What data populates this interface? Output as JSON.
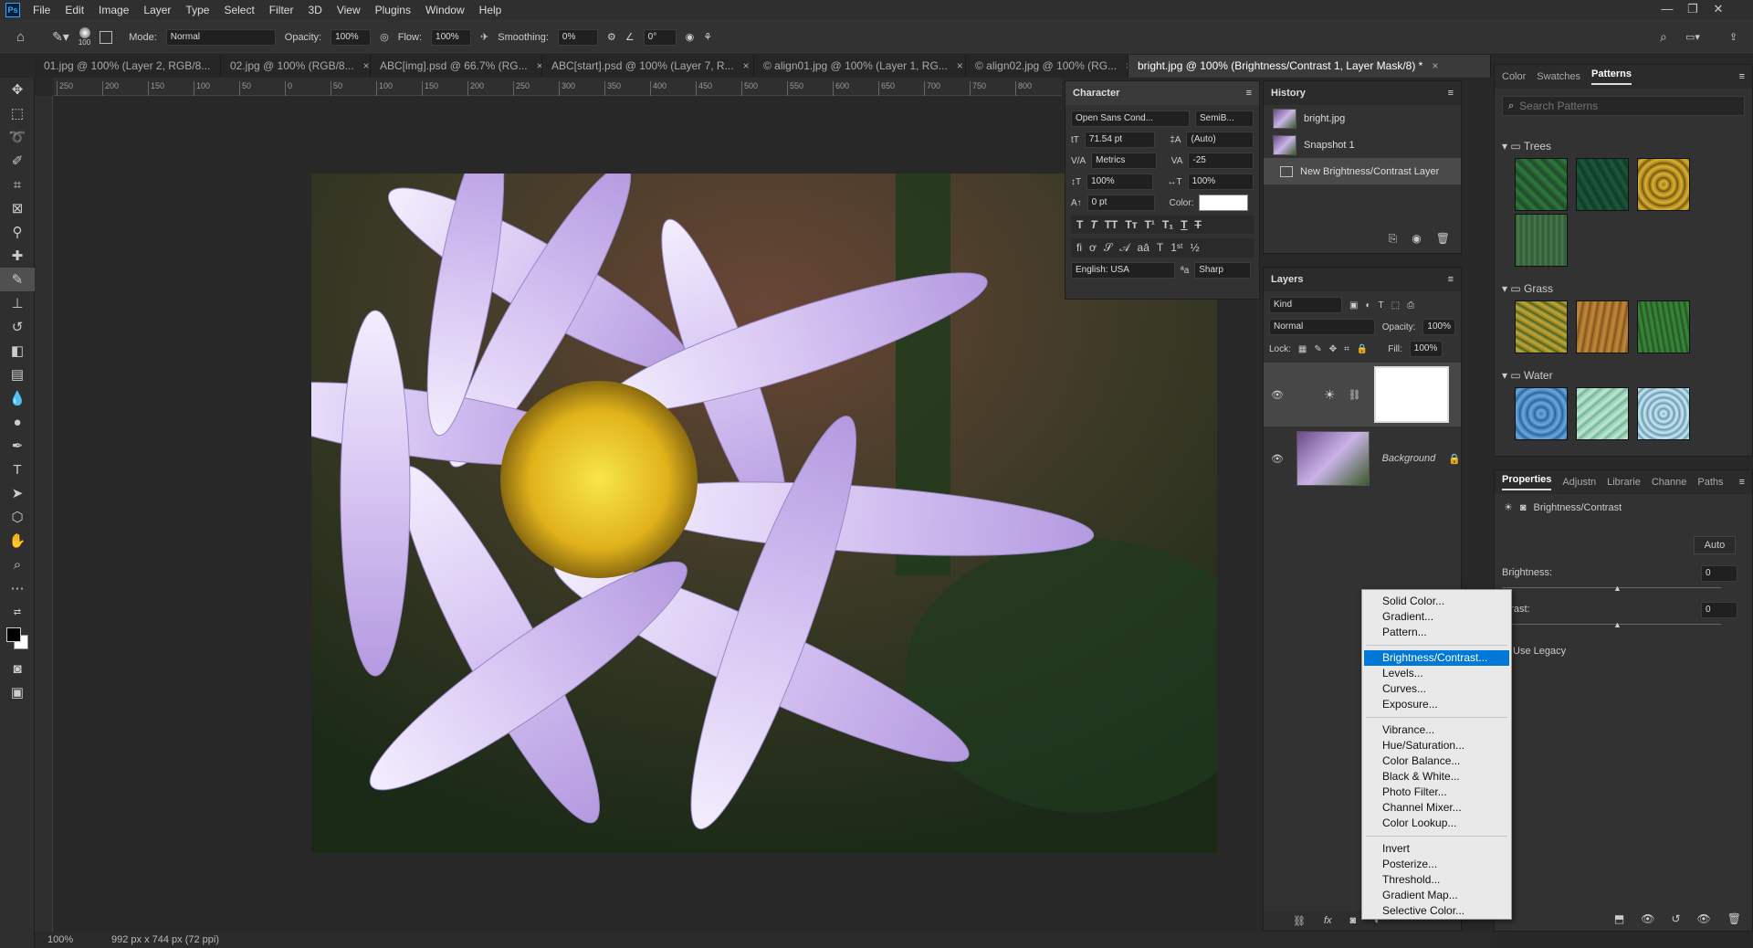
{
  "menubar": {
    "logo": "Ps",
    "items": [
      "File",
      "Edit",
      "Image",
      "Layer",
      "Type",
      "Select",
      "Filter",
      "3D",
      "View",
      "Plugins",
      "Window",
      "Help"
    ],
    "window_controls": [
      "—",
      "❐",
      "✕"
    ]
  },
  "options": {
    "brush_size": "100",
    "mode_label": "Mode:",
    "mode_value": "Normal",
    "opacity_label": "Opacity:",
    "opacity_value": "100%",
    "flow_label": "Flow:",
    "flow_value": "100%",
    "smoothing_label": "Smoothing:",
    "smoothing_value": "0%",
    "angle_value": "0°"
  },
  "tabs": [
    {
      "label": "01.jpg @ 100% (Layer 2, RGB/8..."
    },
    {
      "label": "02.jpg @ 100% (RGB/8..."
    },
    {
      "label": "ABC[img].psd @ 66.7% (RG..."
    },
    {
      "label": "ABC[start].psd @ 100% (Layer 7, R..."
    },
    {
      "label": "© align01.jpg @ 100% (Layer 1, RG..."
    },
    {
      "label": "© align02.jpg @ 100% (RG..."
    },
    {
      "label": "bright.jpg @ 100% (Brightness/Contrast 1, Layer Mask/8) *"
    }
  ],
  "ruler_ticks": [
    "250",
    "200",
    "150",
    "100",
    "50",
    "0",
    "50",
    "100",
    "150",
    "200",
    "250",
    "300",
    "350",
    "400",
    "450",
    "500",
    "550",
    "600",
    "650",
    "700",
    "750",
    "800"
  ],
  "status": {
    "zoom": "100%",
    "doc_info": "992 px x 744 px (72 ppi)"
  },
  "character": {
    "title": "Character",
    "font_family": "Open Sans Cond...",
    "font_style": "SemiB...",
    "size": "71.54 pt",
    "leading": "(Auto)",
    "kerning": "Metrics",
    "tracking": "-25",
    "vscale": "100%",
    "hscale": "100%",
    "baseline": "0 pt",
    "color_label": "Color:",
    "language": "English: USA",
    "aa_label": "ªa",
    "antialias": "Sharp"
  },
  "history": {
    "title": "History",
    "items": [
      "bright.jpg",
      "Snapshot 1",
      "New Brightness/Contrast Layer"
    ]
  },
  "layers": {
    "title": "Layers",
    "kind": "Kind",
    "blend": "Normal",
    "opacity_label": "Opacity:",
    "opacity": "100%",
    "lock_label": "Lock:",
    "fill_label": "Fill:",
    "fill": "100%",
    "background_name": "Background"
  },
  "patterns_panel": {
    "tabs": [
      "Color",
      "Swatches",
      "Patterns"
    ],
    "search_placeholder": "Search Patterns",
    "groups": [
      {
        "name": "Trees",
        "colors": [
          "#1f4a2a",
          "#123a2c",
          "#a07a18",
          "#2f5a35"
        ]
      },
      {
        "name": "Grass",
        "colors": [
          "#8a7a20",
          "#9a6a2a",
          "#2c6a2c"
        ]
      },
      {
        "name": "Water",
        "colors": [
          "#3a7ab8",
          "#8ac8b0",
          "#7ab0c8"
        ]
      }
    ]
  },
  "properties": {
    "tabs": [
      "Properties",
      "Adjustn",
      "Librarie",
      "Channe",
      "Paths"
    ],
    "type": "Brightness/Contrast",
    "auto_label": "Auto",
    "brightness_label": "Brightness:",
    "brightness_value": "0",
    "contrast_label": "ntrast:",
    "contrast_value": "0",
    "legacy_label": "Use Legacy"
  },
  "context_menu": {
    "groups": [
      [
        "Solid Color...",
        "Gradient...",
        "Pattern..."
      ],
      [
        "Brightness/Contrast...",
        "Levels...",
        "Curves...",
        "Exposure..."
      ],
      [
        "Vibrance...",
        "Hue/Saturation...",
        "Color Balance...",
        "Black & White...",
        "Photo Filter...",
        "Channel Mixer...",
        "Color Lookup..."
      ],
      [
        "Invert",
        "Posterize...",
        "Threshold...",
        "Gradient Map...",
        "Selective Color..."
      ]
    ],
    "selected": "Brightness/Contrast..."
  }
}
